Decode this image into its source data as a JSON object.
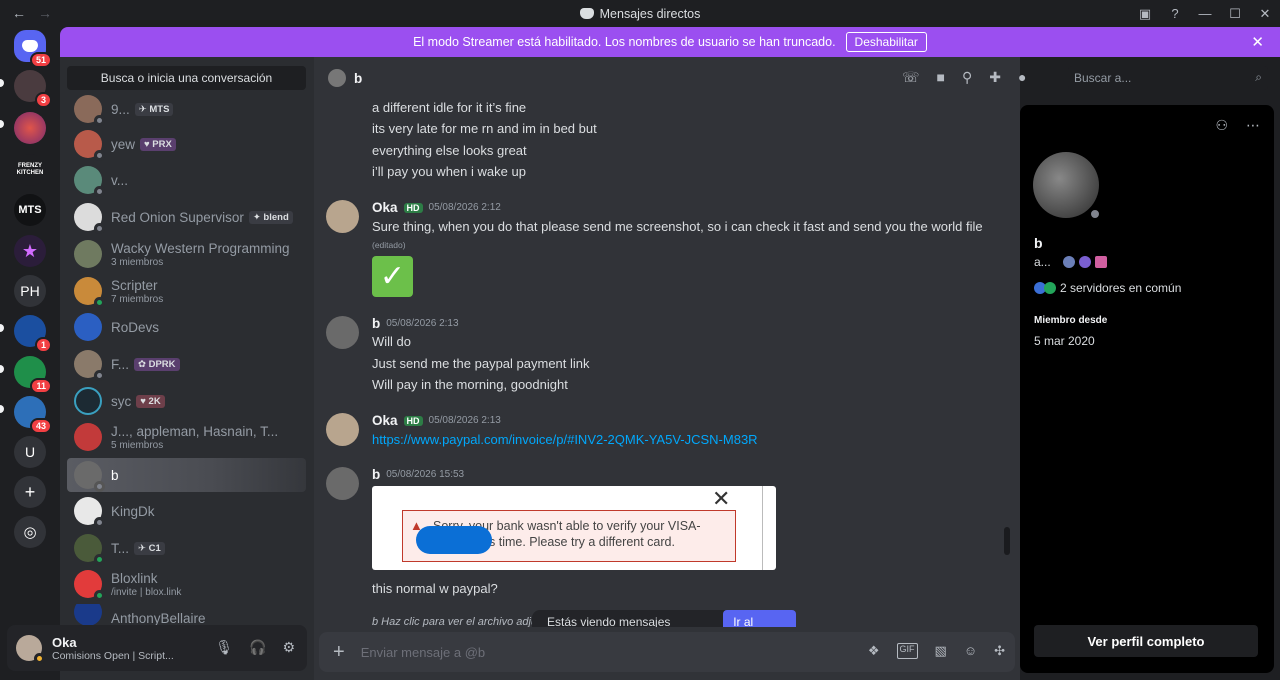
{
  "window": {
    "title": "Mensajes directos",
    "back": "←",
    "forward": "→",
    "inbox_icon": "▣",
    "help_icon": "?",
    "min": "—",
    "max": "☐",
    "close": "✕"
  },
  "banner": {
    "text": "El modo Streamer está habilitado. Los nombres de usuario se han truncado.",
    "button": "Deshabilitar",
    "close": "✕"
  },
  "guilds": {
    "home_badge": "51",
    "items": [
      {
        "label": "",
        "badge": "3"
      },
      {
        "label": "",
        "badge": ""
      },
      {
        "label": "FRENZY KITCHEN",
        "badge": ""
      },
      {
        "label": "MTS",
        "badge": ""
      },
      {
        "label": "★",
        "badge": ""
      },
      {
        "label": "PH",
        "badge": ""
      },
      {
        "label": "",
        "badge": "1"
      },
      {
        "label": "",
        "badge": "11"
      },
      {
        "label": "",
        "badge": "43"
      },
      {
        "label": "U",
        "badge": ""
      },
      {
        "label": "+",
        "badge": ""
      },
      {
        "label": "◎",
        "badge": ""
      }
    ]
  },
  "dm": {
    "search": "Busca o inicia una conversación",
    "items": [
      {
        "name": "9...",
        "tag": "✈ MTS",
        "sub": ""
      },
      {
        "name": "yew",
        "tag": "♥ PRX",
        "sub": ""
      },
      {
        "name": "v...",
        "tag": "",
        "sub": ""
      },
      {
        "name": "Red Onion Supervisor",
        "tag": "✦ blend",
        "sub": ""
      },
      {
        "name": "Wacky Western Programming",
        "tag": "",
        "sub": "3 miembros"
      },
      {
        "name": "Scripter",
        "tag": "",
        "sub": "7 miembros"
      },
      {
        "name": "RoDevs",
        "tag": "",
        "sub": ""
      },
      {
        "name": "F...",
        "tag": "✿ DPRK",
        "sub": ""
      },
      {
        "name": "syc",
        "tag": "♥ 2K",
        "sub": ""
      },
      {
        "name": "J..., appleman, Hasnain, T...",
        "tag": "",
        "sub": "5 miembros"
      },
      {
        "name": "b",
        "tag": "",
        "sub": ""
      },
      {
        "name": "KingDk",
        "tag": "",
        "sub": ""
      },
      {
        "name": "T...",
        "tag": "✈ C1",
        "sub": ""
      },
      {
        "name": "Bloxlink",
        "tag": "",
        "sub": "/invite | blox.link"
      },
      {
        "name": "AnthonyBellaire",
        "tag": "",
        "sub": ""
      }
    ]
  },
  "user": {
    "name": "Oka",
    "status": "Comisions Open | Script...",
    "mic": "🎙",
    "headset": "🎧",
    "settings": "⚙"
  },
  "chat": {
    "name": "b",
    "search_placeholder": "Buscar a...",
    "lines_top": [
      "a different idle for it it’s fine",
      "its very late for me rn and im in bed but",
      "everything else looks great",
      "i’ll pay you when i wake up"
    ],
    "m1": {
      "author": "Oka",
      "hd": "HD",
      "time": "05/08/2026 2:12",
      "text": "Sure thing, when you do that please send me screenshot, so i can check it fast and send you the world file",
      "edited": "(editado)",
      "emoji": "✓"
    },
    "m2": {
      "author": "b",
      "time": "05/08/2026 2:13",
      "lines": [
        "Will do",
        "Just send me the paypal payment link",
        "Will pay in the morning, goodnight"
      ]
    },
    "m3": {
      "author": "Oka",
      "hd": "HD",
      "time": "05/08/2026 2:13",
      "link": "https://www.paypal.com/invoice/p/#INV2-2QMK-YA5V-JCSN-M83R"
    },
    "m4": {
      "author": "b",
      "time": "05/08/2026 15:53",
      "error_line1": "Sorry, your bank wasn't able to verify your VISA-",
      "error_line2": "s time. Please try a different card.",
      "text": "this normal w paypal?",
      "attach": "b Haz clic para ver el archivo adjunto"
    },
    "old": {
      "text": "Estás viendo mensajes antiguos",
      "button": "Ir al actual"
    },
    "composer": "Enviar mensaje a @b"
  },
  "profile": {
    "name": "b",
    "tag": "a...",
    "servers": "2 servidores en común",
    "since_label": "Miembro desde",
    "since": "5 mar 2020",
    "full_button": "Ver perfil completo"
  }
}
